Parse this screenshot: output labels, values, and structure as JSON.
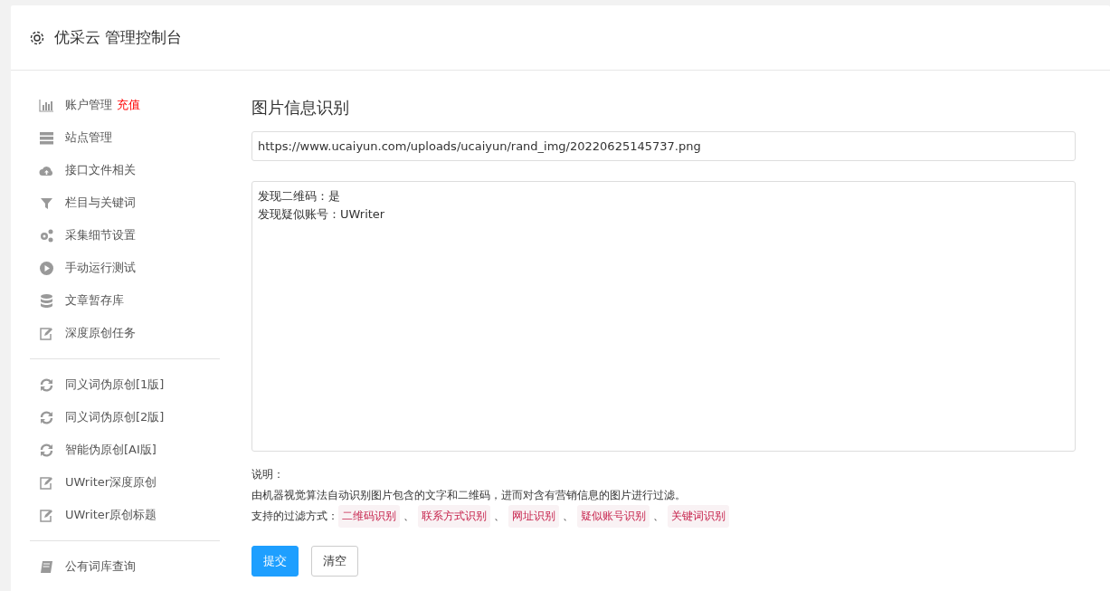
{
  "header": {
    "title": "优采云 管理控制台"
  },
  "sidebar": {
    "groups": [
      [
        {
          "kind": "chart",
          "label": "账户管理",
          "badge": "充值"
        },
        {
          "kind": "server",
          "label": "站点管理"
        },
        {
          "kind": "upload",
          "label": "接口文件相关"
        },
        {
          "kind": "filter",
          "label": "栏目与关键词"
        },
        {
          "kind": "gears",
          "label": "采集细节设置"
        },
        {
          "kind": "run",
          "label": "手动运行测试"
        },
        {
          "kind": "store",
          "label": "文章暂存库"
        },
        {
          "kind": "edit",
          "label": "深度原创任务"
        }
      ],
      [
        {
          "kind": "rewrite",
          "label": "同义词伪原创[1版]"
        },
        {
          "kind": "rewrite",
          "label": "同义词伪原创[2版]"
        },
        {
          "kind": "rewrite",
          "label": "智能伪原创[AI版]"
        },
        {
          "kind": "edit",
          "label": "UWriter深度原创"
        },
        {
          "kind": "edit",
          "label": "UWriter原创标题"
        }
      ],
      [
        {
          "kind": "lexicon",
          "label": "公有词库查询"
        }
      ]
    ]
  },
  "main": {
    "title": "图片信息识别",
    "url_value": "https://www.ucaiyun.com/uploads/ucaiyun/rand_img/20220625145737.png",
    "result_lines": [
      "发现二维码：是",
      "发现疑似账号：UWriter"
    ],
    "note_heading": "说明：",
    "note_text": "由机器视觉算法自动识别图片包含的文字和二维码，进而对含有营销信息的图片进行过滤。",
    "methods_label": "支持的过滤方式：",
    "methods": [
      "二维码识别",
      "联系方式识别",
      "网址识别",
      "疑似账号识别",
      "关键词识别"
    ],
    "separator": "、",
    "buttons": [
      {
        "label": "提交",
        "kind": "primary"
      },
      {
        "label": "清空",
        "kind": "default"
      }
    ]
  }
}
